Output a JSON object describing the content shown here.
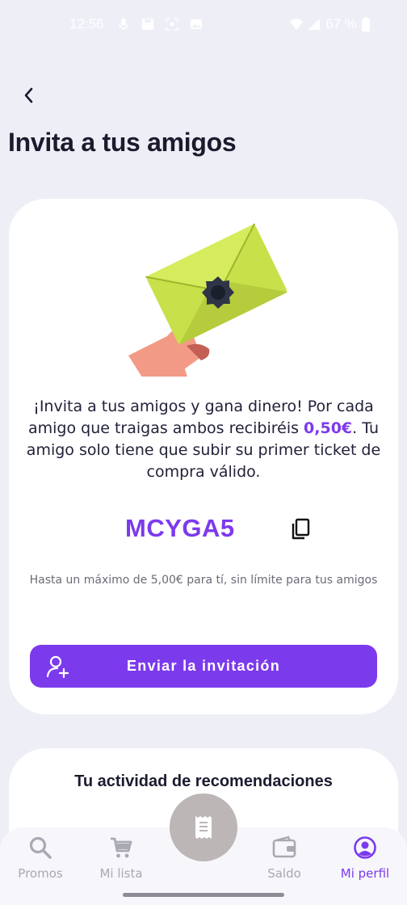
{
  "status_bar": {
    "time": "12:56",
    "battery": "67 %"
  },
  "header": {
    "title": "Invita a tus amigos"
  },
  "invite_card": {
    "text_part1": "¡Invita a tus amigos y gana dinero! Por cada amigo que traigas ambos recibiréis ",
    "amount": "0,50€",
    "text_part2": ". Tu amigo solo tiene que subir su primer ticket de compra válido.",
    "promo_code": "MCYGA5",
    "limit_note": "Hasta un máximo de 5,00€ para tí, sin límite para tus amigos",
    "send_button_label": "Enviar la invitación"
  },
  "activity_card": {
    "title": "Tu actividad de recomendaciones"
  },
  "bottom_nav": {
    "items": [
      {
        "label": "Promos",
        "icon": "search-icon",
        "active": false
      },
      {
        "label": "Mi lista",
        "icon": "cart-icon",
        "active": false
      },
      {
        "label": "Saldo",
        "icon": "wallet-icon",
        "active": false
      },
      {
        "label": "Mi perfil",
        "icon": "profile-icon",
        "active": true
      }
    ],
    "center_action_icon": "receipt-icon"
  },
  "colors": {
    "accent": "#7c3aed",
    "background": "#eeeff6",
    "envelope": "#c8e04a",
    "hand": "#f39a86"
  }
}
